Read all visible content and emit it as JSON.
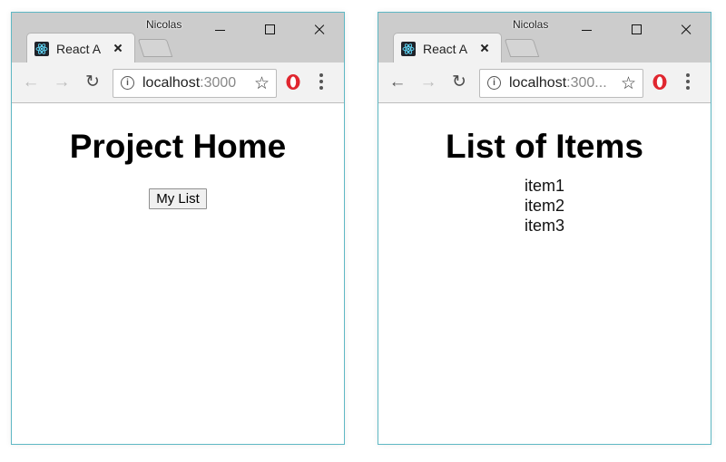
{
  "user_name": "Nicolas",
  "left_window": {
    "tab_title": "React A",
    "url_host": "localhost",
    "url_port": ":3000",
    "heading": "Project Home",
    "button_label": "My List"
  },
  "right_window": {
    "tab_title": "React A",
    "url_host": "localhost",
    "url_port": ":300...",
    "heading": "List of Items",
    "items": [
      "item1",
      "item2",
      "item3"
    ]
  },
  "icons": {
    "back": "arrow-left-icon",
    "forward": "arrow-right-icon",
    "reload": "reload-icon",
    "info": "info-icon",
    "bookmark": "star-icon",
    "extension": "opera-icon",
    "menu": "vertical-dots-icon"
  },
  "colors": {
    "window_border": "#5fb8c4",
    "titlebar": "#cccccc",
    "toolbar": "#f2f2f2",
    "react_blue": "#61dafb",
    "opera_red": "#e0262f"
  }
}
